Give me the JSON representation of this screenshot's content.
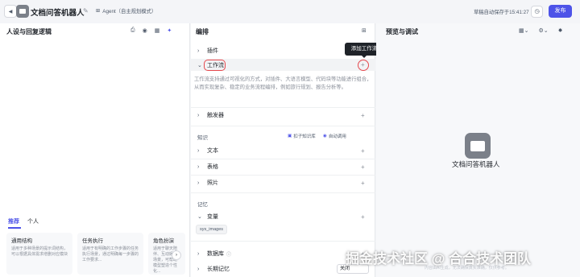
{
  "header": {
    "app_title": "文档问答机器人",
    "agent_mode": "Agent（自主规划模式）",
    "autosave_text": "草稿自动保存于15:41:27",
    "publish_label": "发布"
  },
  "left_panel": {
    "title": "人设与回复逻辑",
    "tabs": [
      "推荐",
      "个人"
    ],
    "cards": [
      {
        "title": "通用结构",
        "desc": "适用于多种场景的提示词结构，可以根据具体需求增删对应模块"
      },
      {
        "title": "任务执行",
        "desc": "适用于有明确的工作步骤的任务执行场景，通过明确每一步骤的工作要求..."
      },
      {
        "title": "角色扮演",
        "desc": "适用于聊天陪伴、互动娱乐场景，可帮助模型塑造个性化..."
      }
    ]
  },
  "mid_panel": {
    "title": "编排",
    "plugin_label": "插件",
    "workflow_label": "工作流",
    "workflow_desc": "工作流支持通过可视化的方式，对插件、大语言模型、代码块等功能进行组合，从而实现复杂、稳定的业务流程编排，例如旅行规划、报告分析等。",
    "tooltip": "添加工作流",
    "trigger_label": "触发器",
    "knowledge_label": "知识",
    "kb_source": "扣子知识库",
    "kb_mode": "自动调用",
    "text_label": "文本",
    "table_label": "表格",
    "photo_label": "照片",
    "memory_label": "记忆",
    "variable_label": "变量",
    "variable_tag": "sys_images",
    "database_label": "数据库",
    "long_memory_label": "长期记忆",
    "long_memory_value": "关闭"
  },
  "right_panel": {
    "title": "预览与调试",
    "bot_name": "文档问答机器人",
    "footer": "内容由AI生成，无法确保真实准确，仅供参考。"
  },
  "watermark": "掘金技术社区 @ 合合技术团队",
  "colors": {
    "accent": "#4d53e8",
    "highlight": "#e5484d"
  }
}
